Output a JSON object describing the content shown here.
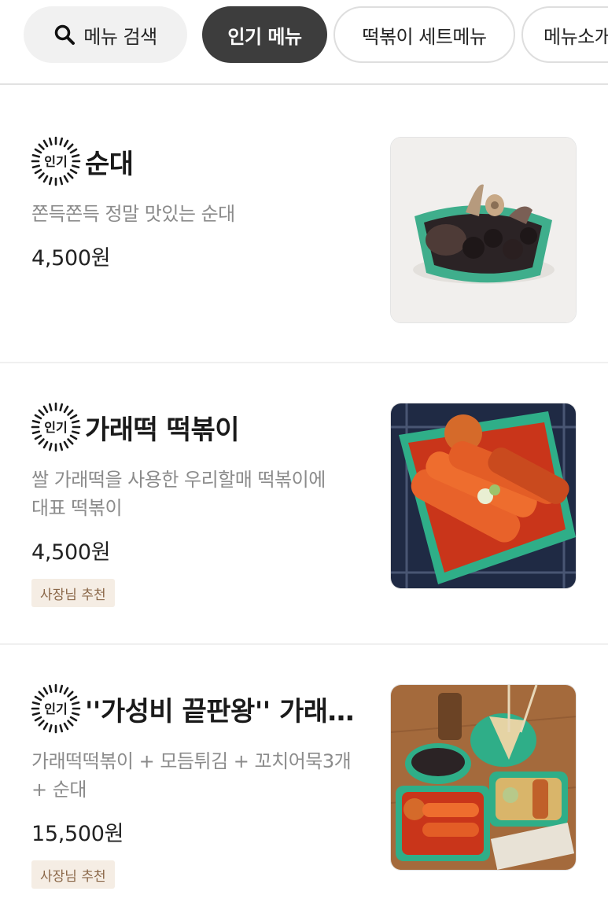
{
  "tabs": {
    "search_label": "메뉴 검색",
    "active_label": "인기 메뉴",
    "tab3_label": "떡볶이 세트메뉴",
    "tab4_label": "메뉴소개"
  },
  "badge_text": "인기",
  "items": [
    {
      "name": "순대",
      "description_lines": [
        "쫀득쫀득 정말 맛있는 순대"
      ],
      "price": "4,500원",
      "tag": ""
    },
    {
      "name": "가래떡 떡볶이",
      "description_lines": [
        "쌀 가래떡을 사용한 우리할매 떡볶이에",
        "대표 떡볶이"
      ],
      "price": "4,500원",
      "tag": "사장님 추천"
    },
    {
      "name": "''가성비 끝판왕'' 가래…",
      "description_lines": [
        "가래떡떡볶이 + 모듬튀김 + 꼬치어묵3개",
        "+ 순대"
      ],
      "price": "15,500원",
      "tag": "사장님 추천"
    }
  ],
  "colors": {
    "active_chip": "#3d3d3d",
    "tag_bg": "#f5ede4",
    "tag_text": "#8a6748",
    "desc_text": "#8b8b8b"
  }
}
